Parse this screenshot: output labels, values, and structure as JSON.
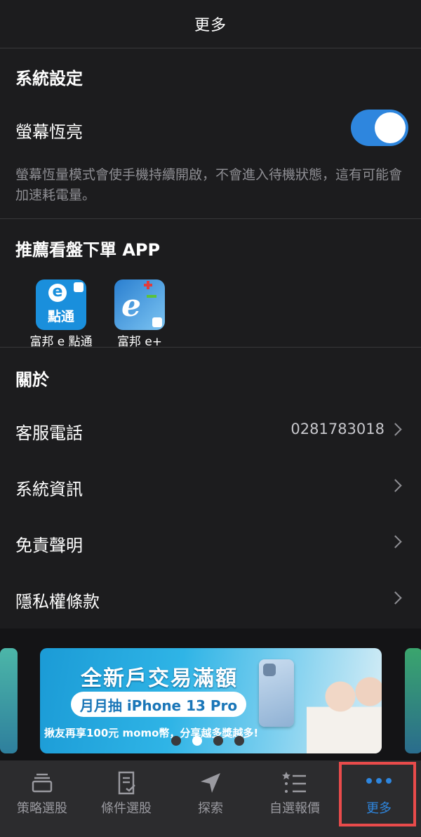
{
  "header": {
    "title": "更多"
  },
  "system_settings": {
    "title": "系統設定",
    "screen_always_on": {
      "label": "螢幕恆亮",
      "enabled": true,
      "description": "螢幕恆量模式會使手機持續開啟，不會進入待機狀態，這有可能會加速耗電量。"
    }
  },
  "recommended_apps": {
    "title": "推薦看盤下單 APP",
    "apps": [
      {
        "name": "富邦 e 點通",
        "icon_text": "點通",
        "icon": "fubon-e-dianton-app-icon"
      },
      {
        "name": "富邦 e+",
        "icon": "fubon-e-plus-app-icon"
      }
    ]
  },
  "about": {
    "title": "關於",
    "items": [
      {
        "label": "客服電話",
        "value": "0281783018"
      },
      {
        "label": "系統資訊"
      },
      {
        "label": "免責聲明"
      },
      {
        "label": "隱私權條款"
      }
    ]
  },
  "banner": {
    "title": "全新戶交易滿額",
    "pill": "月月抽 iPhone 13 Pro",
    "subtitle": "揪友再享100元 momo幣，分享越多獎越多!",
    "page_count": 4,
    "active_index": 1
  },
  "tabbar": {
    "tabs": [
      {
        "label": "策略選股",
        "icon": "layers-icon"
      },
      {
        "label": "條件選股",
        "icon": "document-check-icon"
      },
      {
        "label": "探索",
        "icon": "navigation-arrow-icon"
      },
      {
        "label": "自選報價",
        "icon": "star-list-icon"
      },
      {
        "label": "更多",
        "icon": "more-dots-icon",
        "active": true
      }
    ]
  },
  "colors": {
    "background": "#1c1c1e",
    "accent": "#2e86de",
    "highlight_box": "#e94b4b",
    "secondary_text": "#8e8e93"
  }
}
